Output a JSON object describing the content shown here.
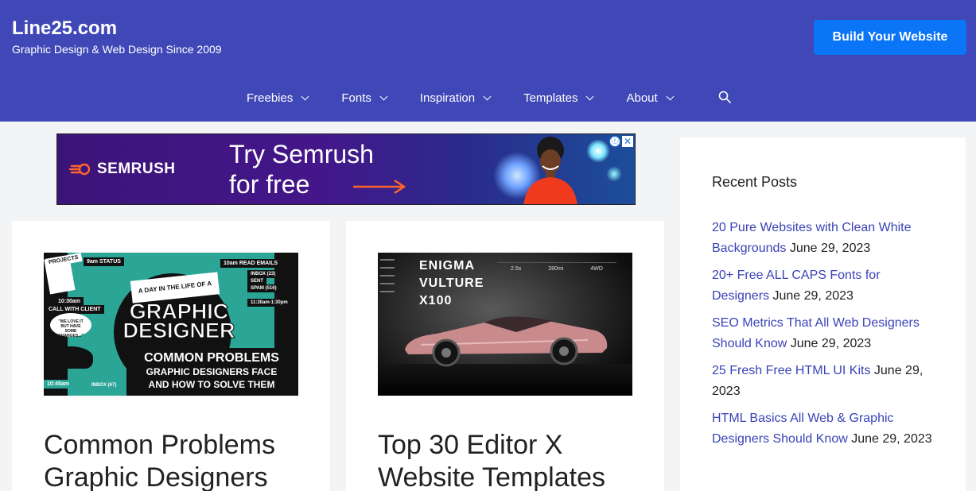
{
  "header": {
    "title": "Line25.com",
    "tagline": "Graphic Design & Web Design Since 2009",
    "cta_label": "Build Your Website",
    "bg_color": "#4048b8",
    "cta_color": "#0a75f6"
  },
  "nav": {
    "items": [
      {
        "label": "Freebies"
      },
      {
        "label": "Fonts"
      },
      {
        "label": "Inspiration"
      },
      {
        "label": "Templates"
      },
      {
        "label": "About"
      }
    ],
    "search_icon": "search-icon"
  },
  "ad": {
    "brand": "SEMRUSH",
    "headline_1": "Try Semrush",
    "headline_2": "for free",
    "info_icon": "ⓘ",
    "close_icon": "✕"
  },
  "cards": [
    {
      "title": "Common Problems Graphic Designers",
      "thumb": {
        "label_projects": "PROJECTS",
        "label_status": "9am STATUS",
        "label_emails": "10am READ EMAILS",
        "inbox": "INBOX (23)",
        "sent": "SENT",
        "spam": "SPAM (516)",
        "call_time": "10:30am",
        "call_label": "CALL WITH CLIENT",
        "lunch": "11:30am-1:30pm",
        "bubble": "\"WE LOVE IT BUT HAVE SOME CHANGES...\"",
        "day_line": "A DAY IN THE LIFE OF A",
        "headline": "GRAPHIC DESIGNER",
        "banner_1": "COMMON PROBLEMS",
        "banner_2": "GRAPHIC DESIGNERS FACE",
        "banner_3": "AND HOW TO SOLVE THEM",
        "time_bottom": "10:45am",
        "inbox_bottom": "INBOX (67)"
      }
    },
    {
      "title": "Top 30 Editor X Website Templates",
      "thumb": {
        "line_1": "ENIGMA",
        "line_2": "VULTURE",
        "line_3": "X100",
        "spec_1": "2.5s",
        "spec_2": "280mi",
        "spec_3": "4WD"
      }
    }
  ],
  "sidebar": {
    "widget_title": "Recent Posts",
    "posts": [
      {
        "title": "20 Pure Websites with Clean White Backgrounds",
        "date": "June 29, 2023"
      },
      {
        "title": "20+ Free ALL CAPS Fonts for Designers",
        "date": "June 29, 2023"
      },
      {
        "title": "SEO Metrics That All Web Designers Should Know",
        "date": "June 29, 2023"
      },
      {
        "title": "25 Fresh Free HTML UI Kits",
        "date": "June 29, 2023"
      },
      {
        "title": "HTML Basics All Web & Graphic Designers Should Know",
        "date": "June 29, 2023"
      }
    ]
  }
}
